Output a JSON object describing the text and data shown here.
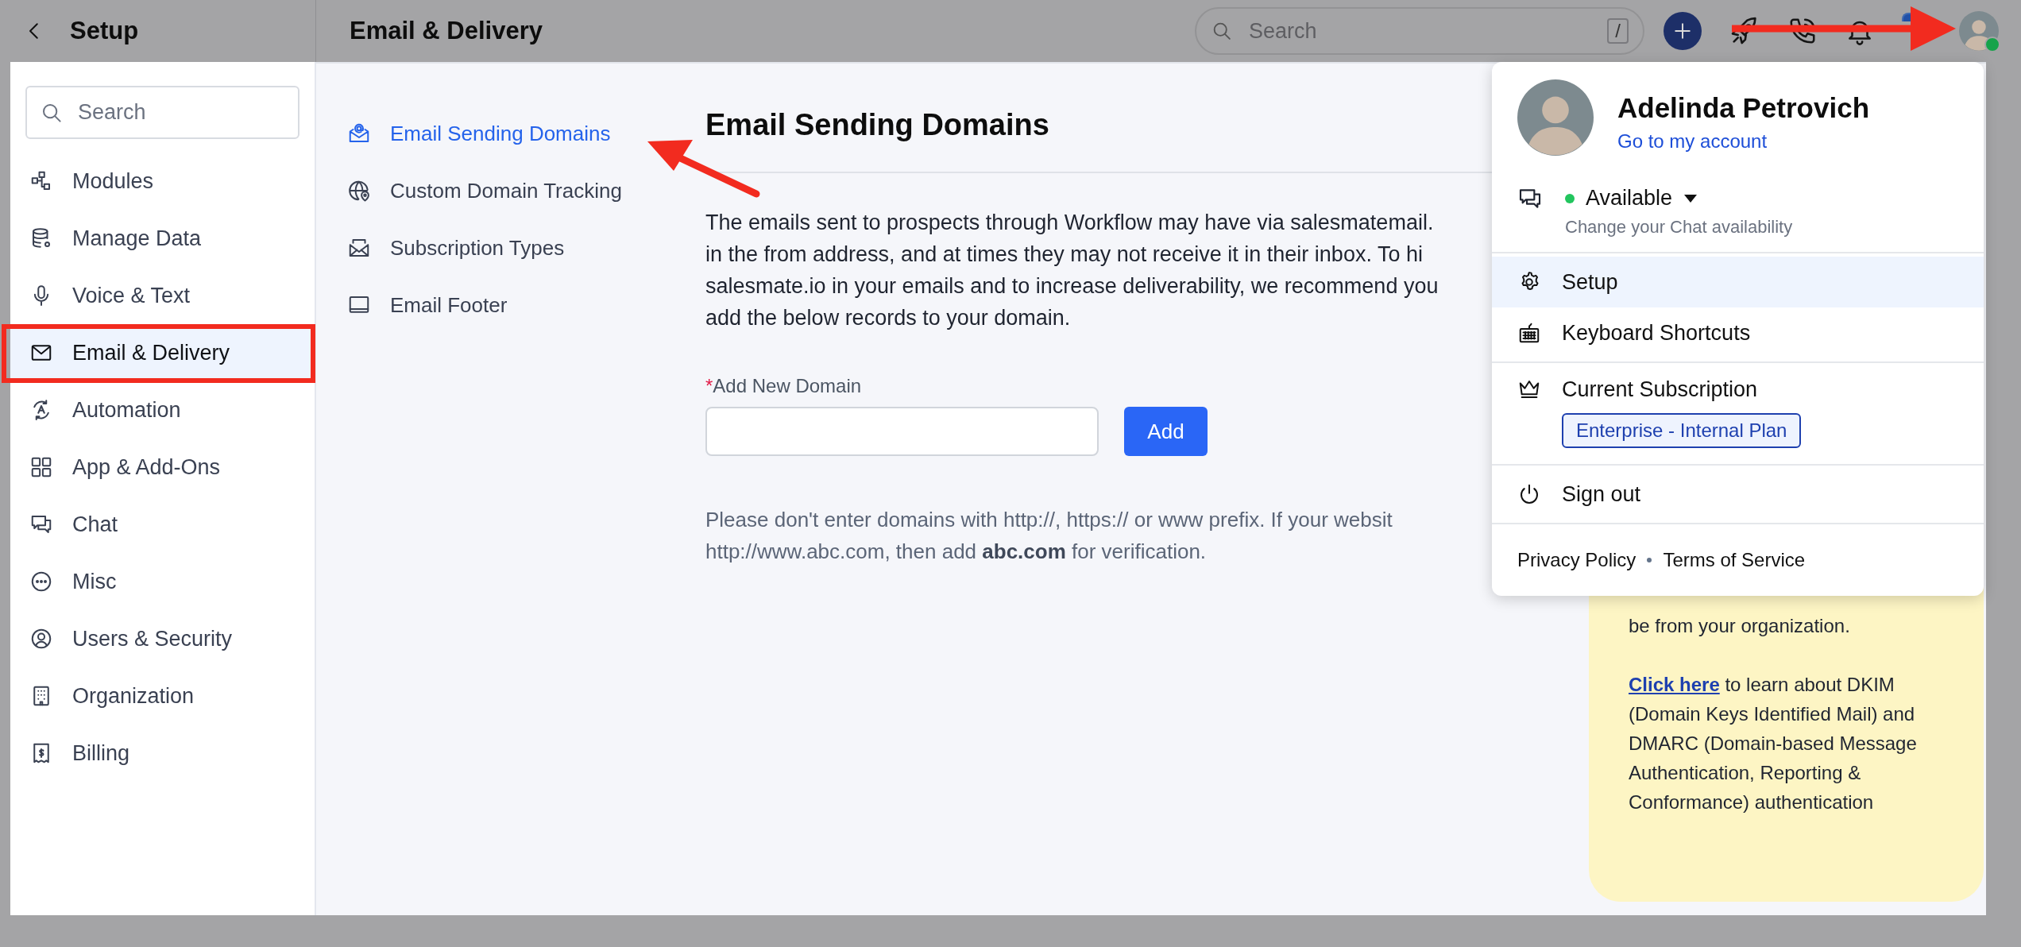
{
  "topbar": {
    "back_title": "Setup",
    "page_title": "Email & Delivery",
    "search": {
      "placeholder": "Search",
      "shortcut": "/"
    },
    "user_online": true
  },
  "sidebar": {
    "search": {
      "placeholder": "Search"
    },
    "items": [
      {
        "label": "Modules",
        "selected": false
      },
      {
        "label": "Manage Data",
        "selected": false
      },
      {
        "label": "Voice & Text",
        "selected": false
      },
      {
        "label": "Email & Delivery",
        "selected": true
      },
      {
        "label": "Automation",
        "selected": false
      },
      {
        "label": "App & Add-Ons",
        "selected": false
      },
      {
        "label": "Chat",
        "selected": false
      },
      {
        "label": "Misc",
        "selected": false
      },
      {
        "label": "Users & Security",
        "selected": false
      },
      {
        "label": "Organization",
        "selected": false
      },
      {
        "label": "Billing",
        "selected": false
      }
    ]
  },
  "subnav": {
    "items": [
      {
        "label": "Email Sending Domains",
        "selected": true
      },
      {
        "label": "Custom Domain Tracking",
        "selected": false
      },
      {
        "label": "Subscription Types",
        "selected": false
      },
      {
        "label": "Email Footer",
        "selected": false
      }
    ]
  },
  "content": {
    "title": "Email Sending Domains",
    "description_lines": [
      "The emails sent to prospects through Workflow may have via salesmatemail.",
      "in the from address, and at times they may not receive it in their inbox. To hi",
      "salesmate.io in your emails and to increase deliverability, we recommend you",
      "add the below records to your domain."
    ],
    "field": {
      "required_mark": "*",
      "label": "Add New Domain"
    },
    "add_button": "Add",
    "note_lines": [
      "Please don't enter domains with http://, https:// or www prefix. If your websit",
      "http://www.abc.com, then add **abc.com** for verification."
    ]
  },
  "info_panel": {
    "lines": [
      "be from your organization."
    ],
    "link": "Click here",
    "link_tail": "to learn about DKIM (Domain Keys Identified Mail) and DMARC (Domain-based Message Authentication, Reporting & Conformance) authentication"
  },
  "user_menu": {
    "name": "Adelinda Petrovich",
    "account_link": "Go to my account",
    "status": {
      "label": "Available",
      "online": true,
      "hint": "Change your Chat availability"
    },
    "sections": [
      [
        {
          "label": "Setup",
          "selected": true
        },
        {
          "label": "Keyboard Shortcuts",
          "selected": false
        }
      ],
      [
        {
          "label": "Current Subscription",
          "selected": false,
          "badge": "Enterprise - Internal Plan"
        }
      ],
      [
        {
          "label": "Sign out",
          "selected": false
        }
      ]
    ],
    "footer_links": [
      "Privacy Policy",
      "Terms of Service"
    ]
  }
}
